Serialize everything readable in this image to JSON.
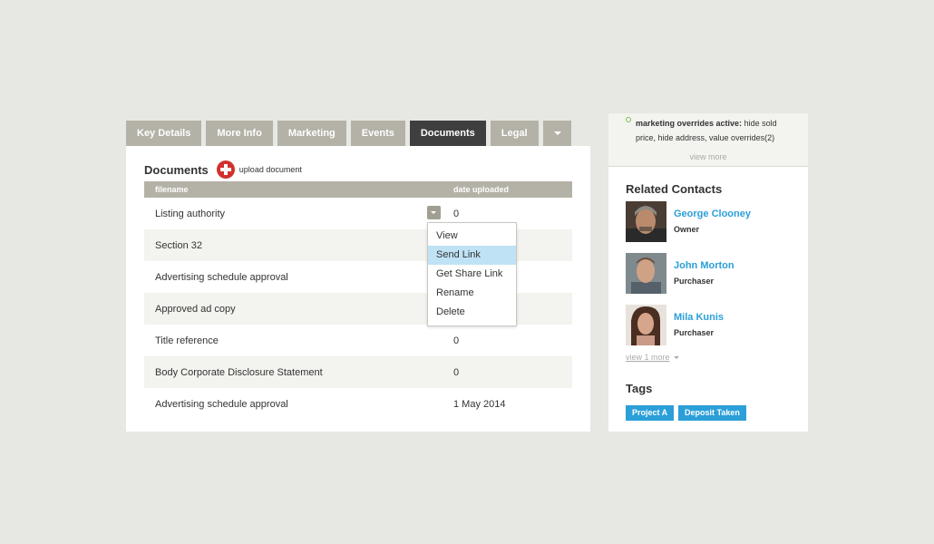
{
  "tabs": [
    "Key Details",
    "More Info",
    "Marketing",
    "Events",
    "Documents",
    "Legal"
  ],
  "active_tab": "Documents",
  "documents": {
    "title": "Documents",
    "upload_label": "upload document",
    "columns": {
      "filename": "filename",
      "date": "date uploaded"
    },
    "rows": [
      {
        "filename": "Listing authority",
        "date": "0"
      },
      {
        "filename": "Section 32",
        "date": ""
      },
      {
        "filename": "Advertising schedule approval",
        "date": ""
      },
      {
        "filename": "Approved ad copy",
        "date": ""
      },
      {
        "filename": "Title reference",
        "date": "0"
      },
      {
        "filename": "Body Corporate Disclosure Statement",
        "date": "0"
      },
      {
        "filename": "Advertising schedule approval",
        "date": "1 May 2014"
      }
    ]
  },
  "menu": {
    "items": [
      "View",
      "Send Link",
      "Get Share Link",
      "Rename",
      "Delete"
    ],
    "highlighted": "Send Link"
  },
  "sidebar": {
    "notice_bold": "marketing overrides active:",
    "notice_text": " hide sold price, hide address, value overrides(2)",
    "view_more": "view more",
    "contacts_title": "Related Contacts",
    "contacts": [
      {
        "name": "George Clooney",
        "role": "Owner"
      },
      {
        "name": "John Morton",
        "role": "Purchaser"
      },
      {
        "name": "Mila Kunis",
        "role": "Purchaser"
      }
    ],
    "view_one_more": "view 1 more",
    "tags_title": "Tags",
    "tags": [
      "Project A",
      "Deposit Taken"
    ]
  },
  "colors": {
    "accent": "#2b9fd8",
    "tab": "#b4b1a7",
    "tab_active": "#3f3f3f",
    "upload": "#d0312d",
    "status": "#7cc24d"
  }
}
